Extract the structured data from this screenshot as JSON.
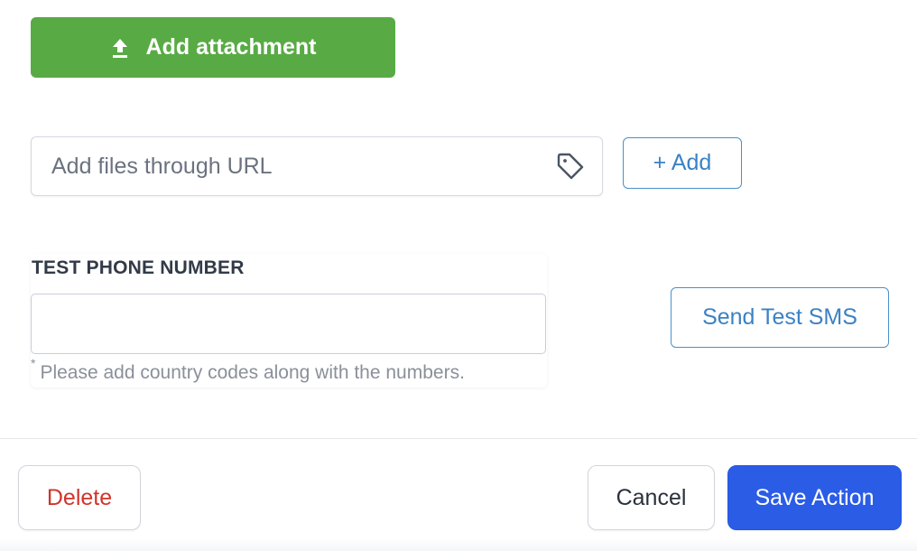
{
  "attachment": {
    "button_label": "Add attachment",
    "icon": "upload-icon"
  },
  "url_input": {
    "placeholder": "Add files through URL",
    "value": "",
    "icon": "tag-icon"
  },
  "add_button": {
    "label": "+ Add"
  },
  "test_phone": {
    "label": "TEST PHONE NUMBER",
    "value": "",
    "hint_marker": "*",
    "hint": "Please add country codes along with the numbers."
  },
  "send_sms_button": {
    "label": "Send Test SMS"
  },
  "footer": {
    "delete_label": "Delete",
    "cancel_label": "Cancel",
    "save_label": "Save Action"
  },
  "colors": {
    "attach_green": "#58ab44",
    "outline_blue": "#3b82c4",
    "save_blue": "#2b5ce6",
    "delete_red": "#d0342c"
  }
}
